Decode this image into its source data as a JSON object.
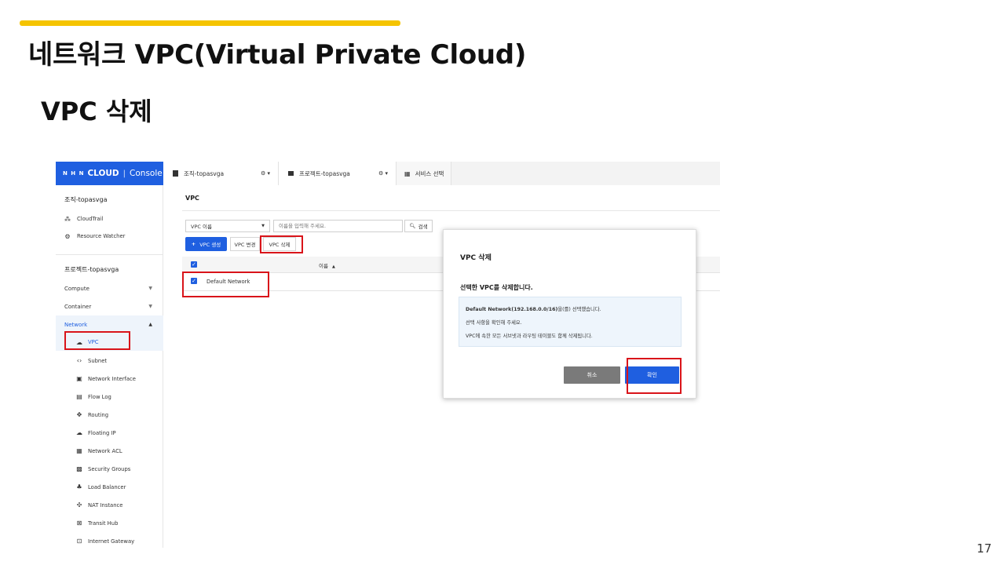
{
  "slide": {
    "title": "네트워크 VPC(Virtual Private Cloud)",
    "subtitle": "VPC 삭제",
    "page_number": "17",
    "accent_color": "#f5c400"
  },
  "console": {
    "brand": {
      "nhn": "N H N",
      "cloud": "CLOUD",
      "sep": "|",
      "console": "Console"
    },
    "tabs": [
      {
        "label": "조직-topasvga",
        "icon": "document-icon"
      },
      {
        "label": "프로젝트-topasvga",
        "icon": "folder-icon"
      },
      {
        "label": "서비스 선택",
        "icon": "grid-icon"
      }
    ],
    "sidebar": {
      "org_name": "조직-topasvga",
      "org_items": [
        "CloudTrail",
        "Resource Watcher"
      ],
      "project_name": "프로젝트-topasvga",
      "categories": [
        "Compute",
        "Container",
        "Network"
      ],
      "network_items": [
        "VPC",
        "Subnet",
        "Network Interface",
        "Flow Log",
        "Routing",
        "Floating IP",
        "Network ACL",
        "Security Groups",
        "Load Balancer",
        "NAT Instance",
        "Transit Hub",
        "Internet Gateway"
      ]
    },
    "main": {
      "title": "VPC",
      "search_select": "VPC 이름",
      "search_placeholder": "이름을 입력해 주세요.",
      "search_button": "검색",
      "create_button": "VPC 생성",
      "edit_button": "VPC 변경",
      "delete_button": "VPC 삭제",
      "column_name": "이름",
      "rows": [
        "Default Network"
      ]
    },
    "modal": {
      "title": "VPC 삭제",
      "question": "선택한 VPC를 삭제합니다.",
      "line1_bold": "Default Network(192.168.0.0/16)",
      "line1_rest": "을(를) 선택했습니다.",
      "line2": "선택 사항을 확인해 주세요.",
      "line3": "VPC에 속한 모든 서브넷과 라우팅 테이블도 함께 삭제됩니다.",
      "cancel": "취소",
      "confirm": "확인"
    },
    "colors": {
      "primary": "#1f5fe0",
      "highlight": "#d9141a",
      "cancel": "#7a7a7a"
    }
  }
}
